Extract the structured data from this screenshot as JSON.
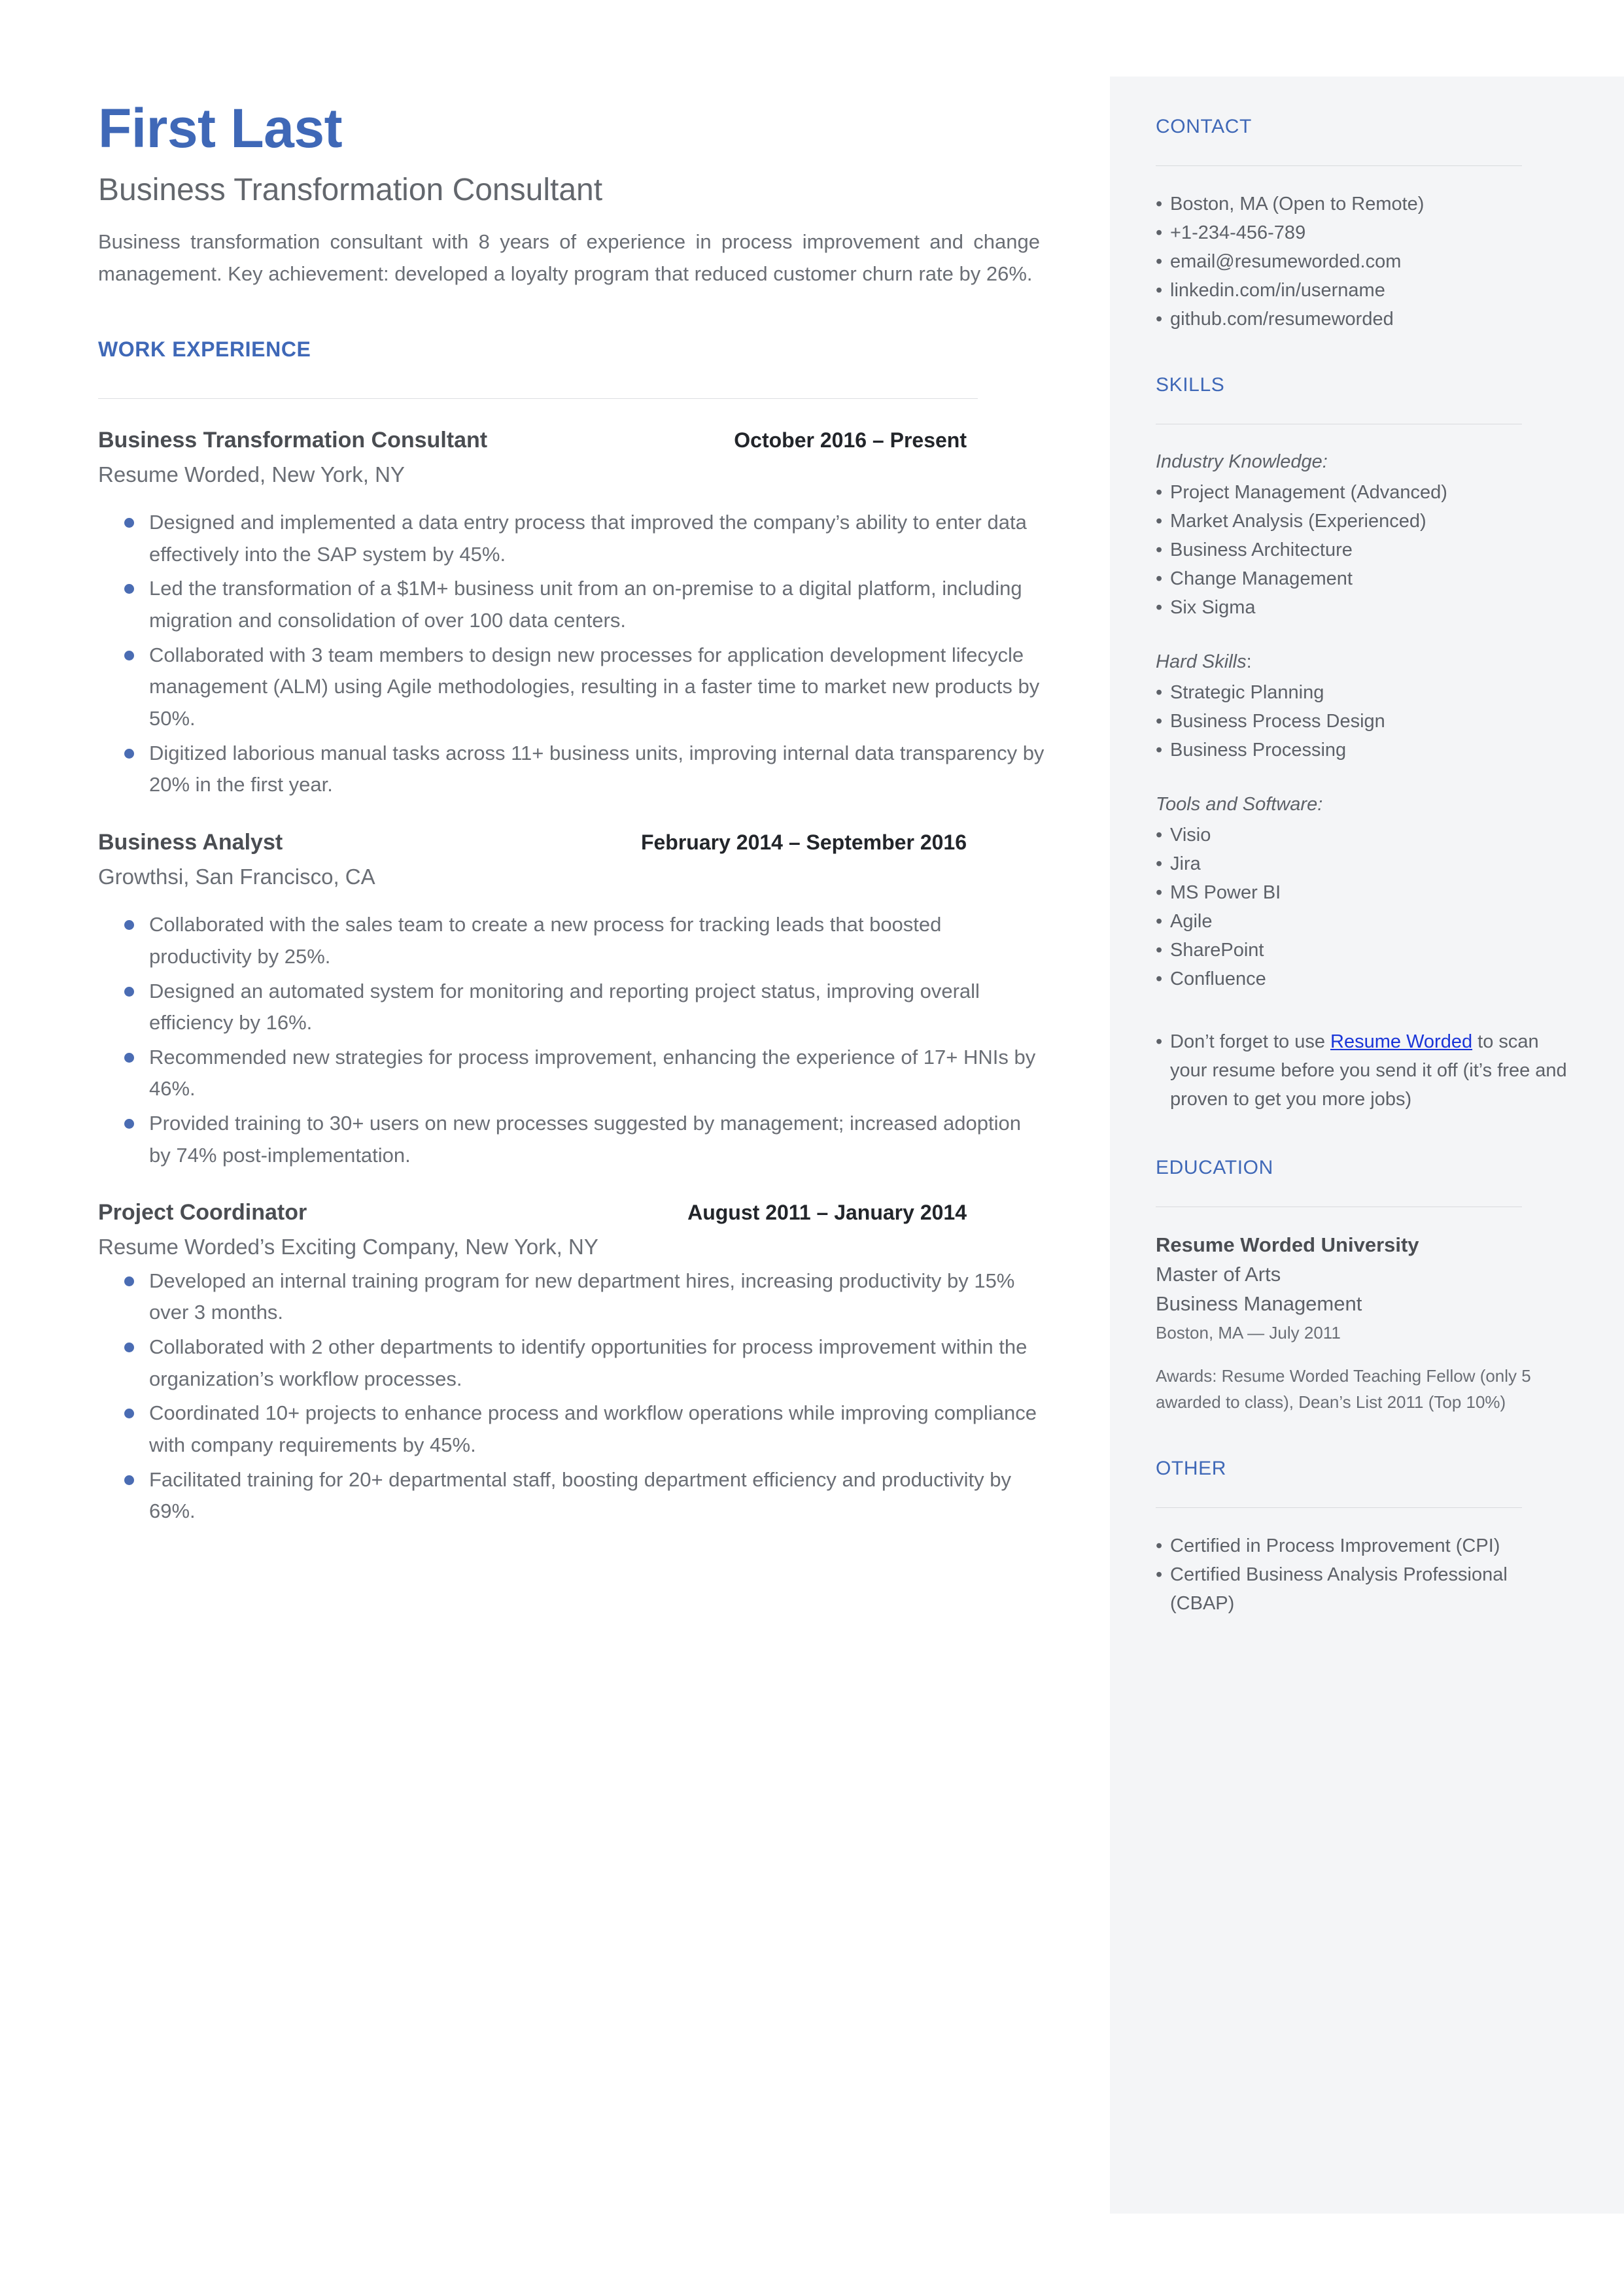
{
  "theme": {
    "accent_blue": "#3f68b7",
    "bullet_blue": "#4a6cb3",
    "link_blue": "#1a35d8",
    "body_grey": "#6a6e75",
    "sidebar_bg": "#f4f5f7"
  },
  "header": {
    "name": "First Last",
    "title": "Business Transformation Consultant",
    "summary": "Business transformation consultant with 8 years of experience in process improvement and change management. Key achievement: developed a loyalty program that reduced customer churn rate by 26%."
  },
  "work": {
    "heading": "WORK EXPERIENCE",
    "jobs": [
      {
        "role": "Business Transformation Consultant",
        "dates": "October 2016 – Present",
        "company": "Resume Worded, New York, NY",
        "bullets": [
          "Designed and implemented a data entry process that improved the company’s ability to enter data effectively into the SAP system by 45%.",
          "Led the transformation of a $1M+ business unit from an on-premise to a digital platform, including migration and consolidation of over 100 data centers.",
          "Collaborated with 3 team members to design new processes for application development lifecycle management (ALM) using Agile methodologies, resulting in a faster time to market new products by 50%.",
          "Digitized laborious manual tasks across 11+ business units, improving internal data transparency by 20% in the first year."
        ]
      },
      {
        "role": "Business Analyst",
        "dates": "February 2014 – September 2016",
        "company": "Growthsi, San Francisco, CA",
        "bullets": [
          "Collaborated with the sales team to create a new process for tracking leads that boosted productivity by 25%.",
          "Designed an automated system for monitoring and reporting project status, improving overall efficiency by 16%.",
          "Recommended new strategies for process improvement, enhancing the experience of 17+ HNIs by 46%.",
          "Provided training to 30+ users on new processes suggested by management; increased adoption by 74% post-implementation."
        ]
      },
      {
        "role": "Project Coordinator",
        "dates": "August 2011 – January 2014",
        "company": "Resume Worded’s Exciting Company, New York, NY",
        "bullets": [
          "Developed an internal training program for new department hires, increasing productivity by 15% over 3 months.",
          "Collaborated with 2 other departments to identify opportunities for process improvement within the organization’s workflow processes.",
          "Coordinated 10+ projects to enhance process and workflow operations while improving compliance with company requirements by 45%.",
          "Facilitated training for 20+ departmental staff, boosting department efficiency and productivity by 69%."
        ]
      }
    ]
  },
  "contact": {
    "heading": "CONTACT",
    "items": [
      "Boston, MA (Open to Remote)",
      "+1-234-456-789",
      "email@resumeworded.com",
      "linkedin.com/in/username",
      "github.com/resumeworded"
    ]
  },
  "skills": {
    "heading": "SKILLS",
    "groups": [
      {
        "label": "Industry Knowledge:",
        "label_italic_part": "Industry Knowledge:",
        "label_plain_part": "",
        "items": [
          "Project Management (Advanced)",
          "Market Analysis (Experienced)",
          "Business Architecture",
          "Change Management",
          "Six Sigma"
        ]
      },
      {
        "label": "Hard Skills:",
        "label_italic_part": "Hard Skills",
        "label_plain_part": ":",
        "items": [
          "Strategic Planning",
          "Business Process Design",
          "Business Processing"
        ]
      },
      {
        "label": "Tools and Software:",
        "label_italic_part": "Tools and Software:",
        "label_plain_part": "",
        "items": [
          "Visio",
          "Jira",
          "MS Power BI",
          "Agile",
          "SharePoint",
          "Confluence"
        ]
      }
    ],
    "promo": {
      "lead": "Don’t forget to use ",
      "link": "Resume Worded",
      "tail": " to scan your resume before you send it off (it’s free and proven to get you more jobs)"
    }
  },
  "education": {
    "heading": "EDUCATION",
    "school": "Resume Worded University",
    "degree": "Master of Arts",
    "field": "Business Management",
    "location_date": "Boston, MA — July 2011",
    "awards": "Awards: Resume Worded Teaching Fellow (only 5 awarded to class), Dean’s List 2011 (Top 10%)"
  },
  "other": {
    "heading": "OTHER",
    "items": [
      "Certified in Process Improvement (CPI)",
      "Certified Business Analysis Professional (CBAP)"
    ]
  }
}
